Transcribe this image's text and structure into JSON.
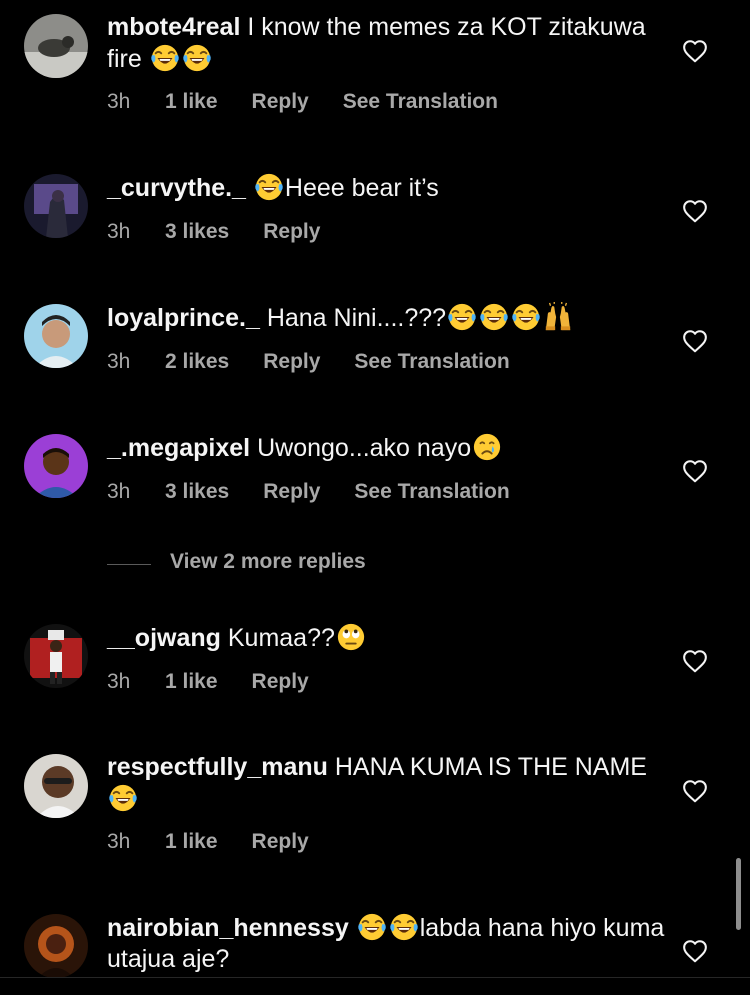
{
  "colors": {
    "background": "#000000",
    "text_primary": "#f5f5f5",
    "text_secondary": "#a8a8a8"
  },
  "comments": [
    {
      "username": "mbote4real",
      "text": "I know the memes za KOT zitakuwa fire",
      "emojis_after": [
        "laughing-tears-emoji",
        "laughing-tears-emoji"
      ],
      "time": "3h",
      "likes": "1 like",
      "reply": "Reply",
      "translation": "See Translation"
    },
    {
      "username": "_curvythe._",
      "text": "Heee bear it’s",
      "emojis_before": [
        "laughing-tears-emoji"
      ],
      "time": "3h",
      "likes": "3 likes",
      "reply": "Reply"
    },
    {
      "username": "loyalprince._",
      "text": "Hana Nini....???",
      "emojis_after": [
        "laughing-tears-emoji",
        "laughing-tears-emoji",
        "laughing-tears-emoji",
        "raising-hands-emoji"
      ],
      "time": "3h",
      "likes": "2 likes",
      "reply": "Reply",
      "translation": "See Translation"
    },
    {
      "username": "_.megapixel",
      "text": "Uwongo...ako nayo",
      "emojis_after": [
        "crying-face-emoji"
      ],
      "time": "3h",
      "likes": "3 likes",
      "reply": "Reply",
      "translation": "See Translation"
    },
    {
      "username": "__ojwang",
      "text": "Kumaa??",
      "emojis_after": [
        "eye-roll-emoji"
      ],
      "time": "3h",
      "likes": "1 like",
      "reply": "Reply"
    },
    {
      "username": "respectfully_manu",
      "text": "HANA KUMA IS THE NAME",
      "emojis_after": [
        "laughing-tears-emoji"
      ],
      "time": "3h",
      "likes": "1 like",
      "reply": "Reply"
    },
    {
      "username": "nairobian_hennessy",
      "text": "labda hana hiyo kuma utajua aje?",
      "emojis_before": [
        "laughing-tears-emoji",
        "laughing-tears-emoji"
      ]
    }
  ],
  "view_more_replies": "View 2 more replies"
}
